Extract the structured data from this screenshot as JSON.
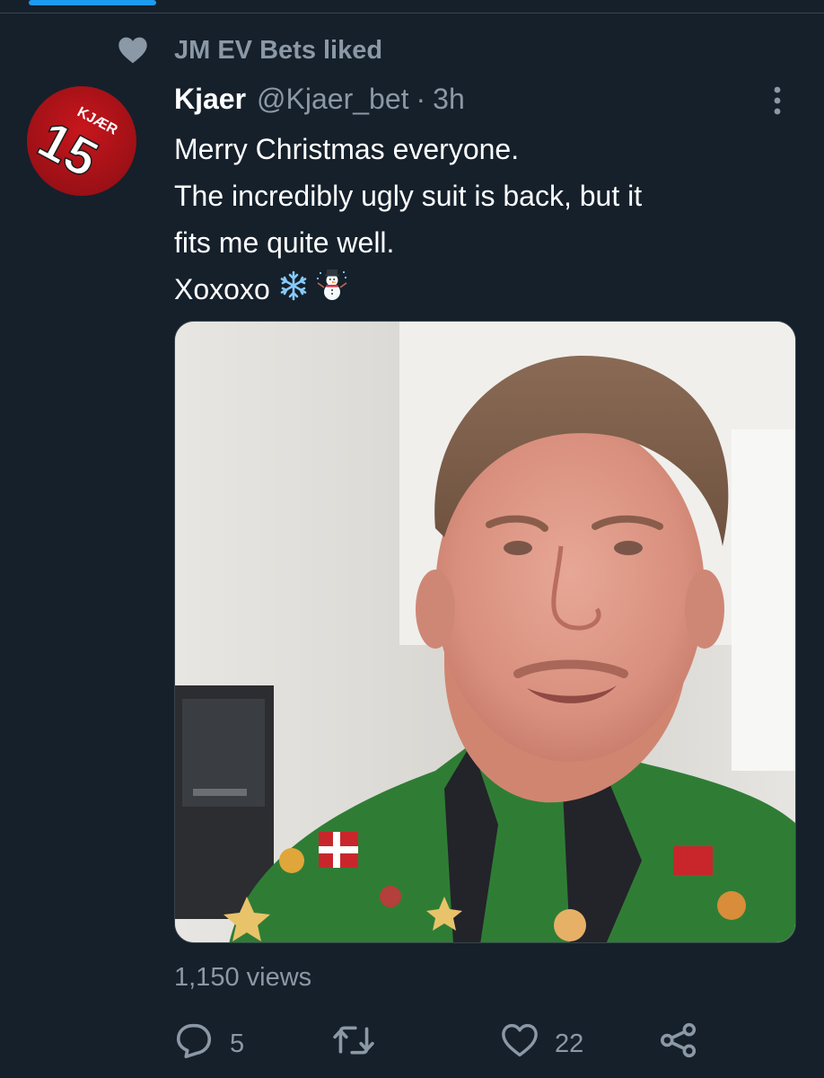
{
  "social_context": {
    "icon": "heart-icon",
    "text": "JM EV Bets liked"
  },
  "tweet": {
    "author_name": "Kjaer",
    "author_handle": "@Kjaer_bet",
    "separator": "·",
    "time": "3h",
    "avatar": {
      "jersey_name": "KJÆR",
      "jersey_number": "15"
    },
    "text_lines": [
      "Merry Christmas everyone.",
      "The incredibly ugly suit is back, but it",
      "fits me quite well.",
      "Xoxoxo"
    ],
    "emojis": [
      "snowflake-icon",
      "snowman-icon"
    ],
    "views": "1,150 views"
  },
  "actions": {
    "reply_count": "5",
    "retweet_count": "",
    "like_count": "22"
  },
  "colors": {
    "background": "#15202b",
    "muted_text": "#8b98a5",
    "accent": "#1d9bf0",
    "border": "#38444d"
  }
}
